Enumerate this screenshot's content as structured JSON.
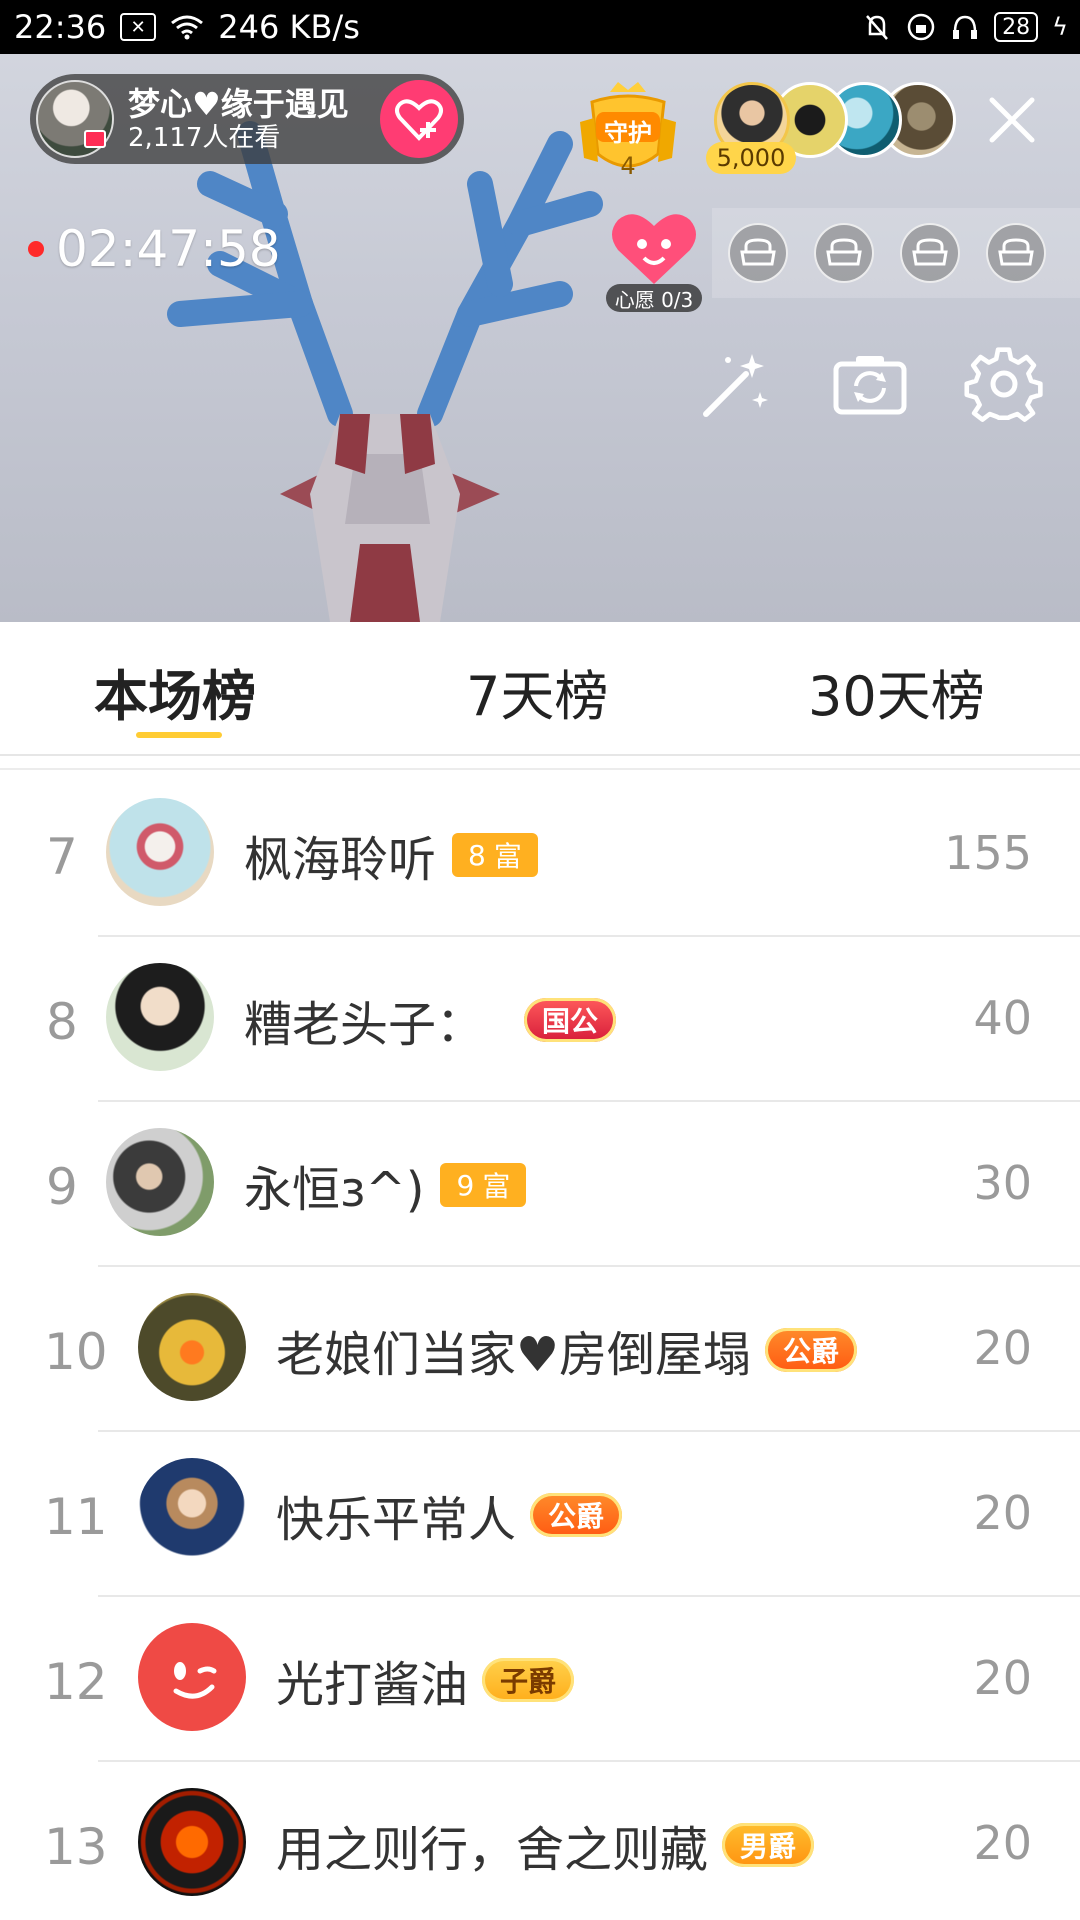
{
  "status_bar": {
    "time": "22:36",
    "speed": "246 KB/s",
    "battery": "28"
  },
  "live": {
    "host_name": "梦心♥缘于遇见",
    "viewers": "2,117人在看",
    "guard_label": "守护",
    "guard_count": "4",
    "top_score": "5,000",
    "timer": "02:47:58",
    "wish_label": "心愿 0/3"
  },
  "tabs": [
    {
      "label": "本场榜",
      "active": true
    },
    {
      "label": "7天榜",
      "active": false
    },
    {
      "label": "30天榜",
      "active": false
    }
  ],
  "ranking": [
    {
      "rank": "7",
      "name": "枫海聆听",
      "badge_type": "rich",
      "badge_level": "8",
      "badge_text": "富",
      "score": "155"
    },
    {
      "rank": "8",
      "name": "糟老头子：",
      "badge_type": "noble",
      "badge_text": "国公",
      "score": "40"
    },
    {
      "rank": "9",
      "name": "永恒ɜ^)",
      "badge_type": "rich",
      "badge_level": "9",
      "badge_text": "富",
      "score": "30"
    },
    {
      "rank": "10",
      "name": "老娘们当家♥房倒屋塌",
      "badge_type": "noble",
      "badge_text": "公爵",
      "score": "20"
    },
    {
      "rank": "11",
      "name": "快乐平常人",
      "badge_type": "noble",
      "badge_text": "公爵",
      "score": "20"
    },
    {
      "rank": "12",
      "name": "光打酱油",
      "badge_type": "noble",
      "badge_text": "子爵",
      "score": "20"
    },
    {
      "rank": "13",
      "name": "用之则行，舍之则藏",
      "badge_type": "noble",
      "badge_text": "男爵",
      "score": "20"
    }
  ],
  "colors": {
    "accent_yellow": "#ffcc33",
    "follow_pink": "#ff3c73",
    "rich_badge": "#ffb020"
  }
}
